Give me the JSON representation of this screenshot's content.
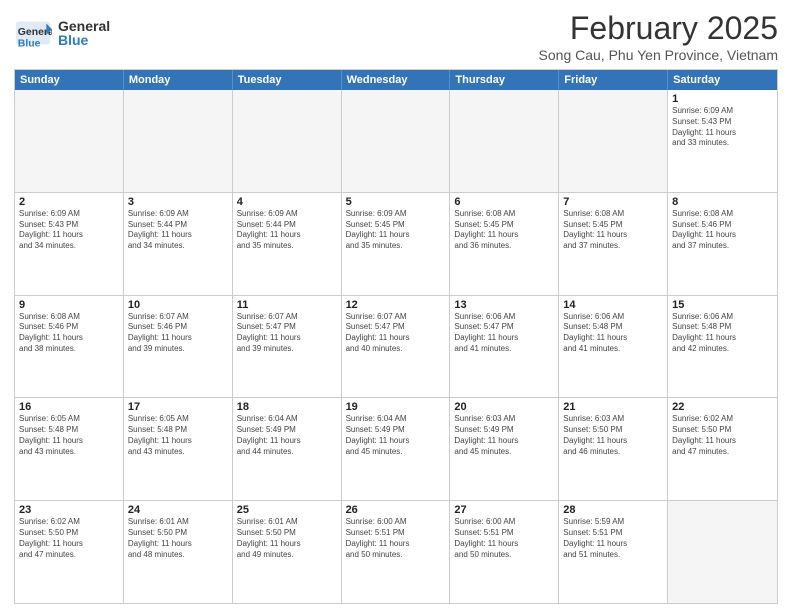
{
  "header": {
    "logo": {
      "general": "General",
      "blue": "Blue"
    },
    "title": "February 2025",
    "subtitle": "Song Cau, Phu Yen Province, Vietnam"
  },
  "calendar": {
    "weekdays": [
      "Sunday",
      "Monday",
      "Tuesday",
      "Wednesday",
      "Thursday",
      "Friday",
      "Saturday"
    ],
    "rows": [
      [
        {
          "day": "",
          "info": ""
        },
        {
          "day": "",
          "info": ""
        },
        {
          "day": "",
          "info": ""
        },
        {
          "day": "",
          "info": ""
        },
        {
          "day": "",
          "info": ""
        },
        {
          "day": "",
          "info": ""
        },
        {
          "day": "1",
          "info": "Sunrise: 6:09 AM\nSunset: 5:43 PM\nDaylight: 11 hours\nand 33 minutes."
        }
      ],
      [
        {
          "day": "2",
          "info": "Sunrise: 6:09 AM\nSunset: 5:43 PM\nDaylight: 11 hours\nand 34 minutes."
        },
        {
          "day": "3",
          "info": "Sunrise: 6:09 AM\nSunset: 5:44 PM\nDaylight: 11 hours\nand 34 minutes."
        },
        {
          "day": "4",
          "info": "Sunrise: 6:09 AM\nSunset: 5:44 PM\nDaylight: 11 hours\nand 35 minutes."
        },
        {
          "day": "5",
          "info": "Sunrise: 6:09 AM\nSunset: 5:45 PM\nDaylight: 11 hours\nand 35 minutes."
        },
        {
          "day": "6",
          "info": "Sunrise: 6:08 AM\nSunset: 5:45 PM\nDaylight: 11 hours\nand 36 minutes."
        },
        {
          "day": "7",
          "info": "Sunrise: 6:08 AM\nSunset: 5:45 PM\nDaylight: 11 hours\nand 37 minutes."
        },
        {
          "day": "8",
          "info": "Sunrise: 6:08 AM\nSunset: 5:46 PM\nDaylight: 11 hours\nand 37 minutes."
        }
      ],
      [
        {
          "day": "9",
          "info": "Sunrise: 6:08 AM\nSunset: 5:46 PM\nDaylight: 11 hours\nand 38 minutes."
        },
        {
          "day": "10",
          "info": "Sunrise: 6:07 AM\nSunset: 5:46 PM\nDaylight: 11 hours\nand 39 minutes."
        },
        {
          "day": "11",
          "info": "Sunrise: 6:07 AM\nSunset: 5:47 PM\nDaylight: 11 hours\nand 39 minutes."
        },
        {
          "day": "12",
          "info": "Sunrise: 6:07 AM\nSunset: 5:47 PM\nDaylight: 11 hours\nand 40 minutes."
        },
        {
          "day": "13",
          "info": "Sunrise: 6:06 AM\nSunset: 5:47 PM\nDaylight: 11 hours\nand 41 minutes."
        },
        {
          "day": "14",
          "info": "Sunrise: 6:06 AM\nSunset: 5:48 PM\nDaylight: 11 hours\nand 41 minutes."
        },
        {
          "day": "15",
          "info": "Sunrise: 6:06 AM\nSunset: 5:48 PM\nDaylight: 11 hours\nand 42 minutes."
        }
      ],
      [
        {
          "day": "16",
          "info": "Sunrise: 6:05 AM\nSunset: 5:48 PM\nDaylight: 11 hours\nand 43 minutes."
        },
        {
          "day": "17",
          "info": "Sunrise: 6:05 AM\nSunset: 5:48 PM\nDaylight: 11 hours\nand 43 minutes."
        },
        {
          "day": "18",
          "info": "Sunrise: 6:04 AM\nSunset: 5:49 PM\nDaylight: 11 hours\nand 44 minutes."
        },
        {
          "day": "19",
          "info": "Sunrise: 6:04 AM\nSunset: 5:49 PM\nDaylight: 11 hours\nand 45 minutes."
        },
        {
          "day": "20",
          "info": "Sunrise: 6:03 AM\nSunset: 5:49 PM\nDaylight: 11 hours\nand 45 minutes."
        },
        {
          "day": "21",
          "info": "Sunrise: 6:03 AM\nSunset: 5:50 PM\nDaylight: 11 hours\nand 46 minutes."
        },
        {
          "day": "22",
          "info": "Sunrise: 6:02 AM\nSunset: 5:50 PM\nDaylight: 11 hours\nand 47 minutes."
        }
      ],
      [
        {
          "day": "23",
          "info": "Sunrise: 6:02 AM\nSunset: 5:50 PM\nDaylight: 11 hours\nand 47 minutes."
        },
        {
          "day": "24",
          "info": "Sunrise: 6:01 AM\nSunset: 5:50 PM\nDaylight: 11 hours\nand 48 minutes."
        },
        {
          "day": "25",
          "info": "Sunrise: 6:01 AM\nSunset: 5:50 PM\nDaylight: 11 hours\nand 49 minutes."
        },
        {
          "day": "26",
          "info": "Sunrise: 6:00 AM\nSunset: 5:51 PM\nDaylight: 11 hours\nand 50 minutes."
        },
        {
          "day": "27",
          "info": "Sunrise: 6:00 AM\nSunset: 5:51 PM\nDaylight: 11 hours\nand 50 minutes."
        },
        {
          "day": "28",
          "info": "Sunrise: 5:59 AM\nSunset: 5:51 PM\nDaylight: 11 hours\nand 51 minutes."
        },
        {
          "day": "",
          "info": ""
        }
      ]
    ]
  }
}
